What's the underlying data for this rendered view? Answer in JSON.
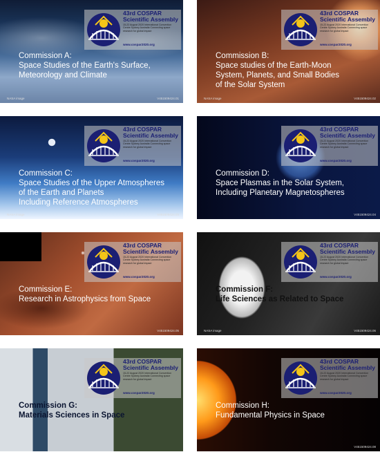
{
  "logo": {
    "title_line1": "43rd COSPAR",
    "title_line2": "Scientific Assembly",
    "subtitle": "15-22 August 2020 International Convention Centre Sydney Australia Connecting space research for global impact",
    "url": "www.cospar2020.org"
  },
  "cards": [
    {
      "line1": "Commission A:",
      "line2": "Space Studies of the Earth's Surface,",
      "line3": "Meteorology and Climate",
      "line4": "",
      "credit": "NASA image",
      "code": "V451509424.01"
    },
    {
      "line1": "Commission B:",
      "line2": "Space studies of the Earth-Moon",
      "line3": "System, Planets, and Small Bodies",
      "line4": "of the Solar System",
      "credit": "NASA image",
      "code": "V451509424.02"
    },
    {
      "line1": "Commission C:",
      "line2": "Space Studies of the Upper Atmospheres",
      "line3": "of the Earth and Planets",
      "line4": "Including Reference Atmospheres",
      "credit": "NASA image",
      "code": "V451509424.03"
    },
    {
      "line1": "Commission D:",
      "line2": "Space Plasmas in the Solar System,",
      "line3": "Including Planetary Magnetospheres",
      "line4": "",
      "credit": "",
      "code": "V451509424.04"
    },
    {
      "line1": "Commission E:",
      "line2": "Research in Astrophysics from Space",
      "line3": "",
      "line4": "",
      "credit": "",
      "code": "V451509424.05"
    },
    {
      "line1": "Commission F:",
      "line2": "Life Sciences as Related to Space",
      "line3": "",
      "line4": "",
      "credit": "NASA image",
      "code": "V451509424.06"
    },
    {
      "line1": "Commission G:",
      "line2": "Materials Sciences in Space",
      "line3": "",
      "line4": "",
      "credit": "",
      "code": ""
    },
    {
      "line1": "Commission H:",
      "line2": "Fundamental Physics in Space",
      "line3": "",
      "line4": "",
      "credit": "",
      "code": "V451509424.08"
    }
  ]
}
